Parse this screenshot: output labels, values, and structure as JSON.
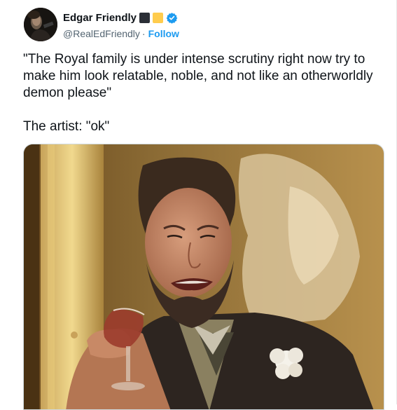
{
  "tweet": {
    "display_name": "Edgar Friendly",
    "handle": "@RealEdFriendly",
    "separator": "·",
    "follow_label": "Follow",
    "text": "\"The Royal family is under intense scrutiny right now try to make him look relatable, noble, and not like an otherworldly demon please\"\n\nThe artist:  \"ok\"",
    "media": {
      "type": "photo"
    }
  },
  "colors": {
    "accent": "#1d9bf0",
    "text_primary": "#0f1419",
    "text_secondary": "#536471"
  },
  "icons": {
    "verified": "verified-badge-icon",
    "emoji_black": "black-square-icon",
    "emoji_yellow": "yellow-square-icon"
  }
}
